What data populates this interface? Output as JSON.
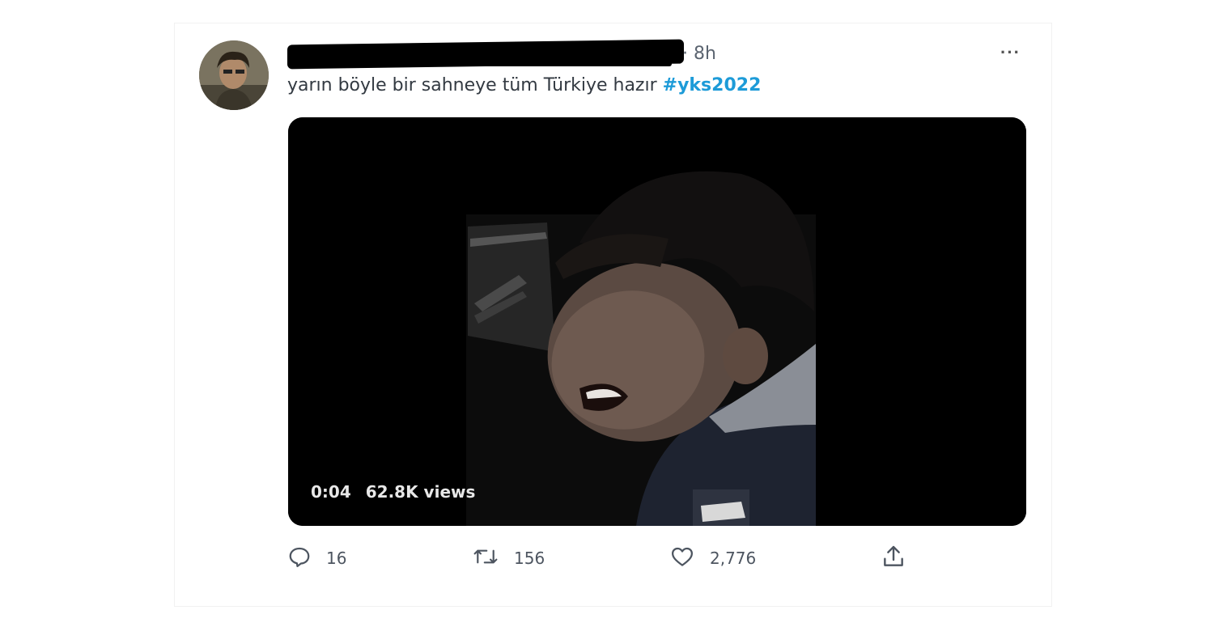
{
  "tweet": {
    "time": "· 8h",
    "more_label": "···",
    "text": "yarın böyle bir sahneye tüm Türkiye hazır ",
    "hashtag": "#yks2022"
  },
  "video": {
    "duration": "0:04",
    "views": "62.8K views"
  },
  "actions": {
    "reply_count": "16",
    "retweet_count": "156",
    "like_count": "2,776"
  },
  "colors": {
    "hashtag": "#1d9bd8",
    "text": "#333a42",
    "muted": "#5b6470"
  },
  "icons": [
    "reply-icon",
    "retweet-icon",
    "like-icon",
    "share-icon",
    "more-icon"
  ]
}
